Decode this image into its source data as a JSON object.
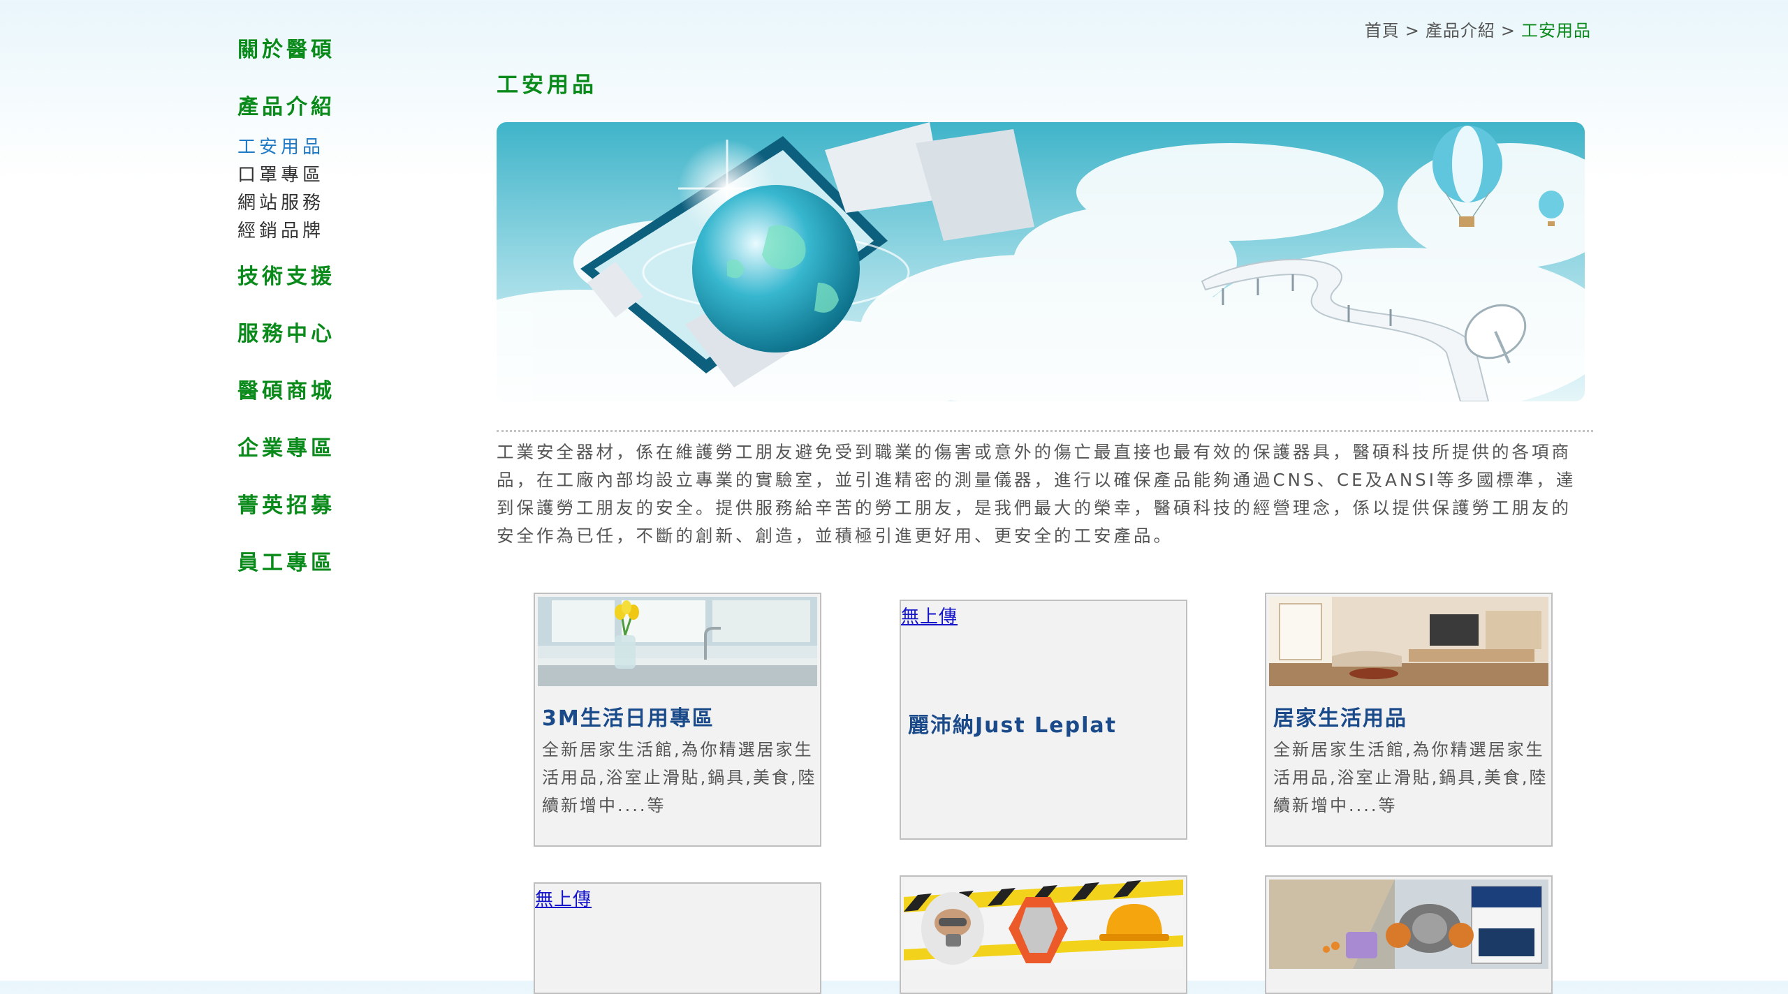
{
  "sidebar": {
    "items": [
      {
        "label": "關於醫碩"
      },
      {
        "label": "產品介紹",
        "children": [
          {
            "label": "工安用品",
            "active": true
          },
          {
            "label": "口罩專區"
          },
          {
            "label": "網站服務"
          },
          {
            "label": "經銷品牌"
          }
        ]
      },
      {
        "label": "技術支援"
      },
      {
        "label": "服務中心"
      },
      {
        "label": "醫碩商城"
      },
      {
        "label": "企業專區"
      },
      {
        "label": "菁英招募"
      },
      {
        "label": "員工專區"
      }
    ]
  },
  "breadcrumb": {
    "items": [
      "首頁",
      "產品介紹",
      "工安用品"
    ],
    "separator": ">"
  },
  "page_title": "工安用品",
  "intro_text": "工業安全器材，係在維護勞工朋友避免受到職業的傷害或意外的傷亡最直接也最有效的保護器具，醫碩科技所提供的各項商品，在工廠內部均設立專業的實驗室，並引進精密的測量儀器，進行以確保產品能夠通過CNS、CE及ANSI等多國標準，達到保護勞工朋友的安全。提供服務給辛苦的勞工朋友，是我們最大的榮幸，醫碩科技的經營理念，係以提供保護勞工朋友的安全作為已任，不斷的創新、創造，並積極引進更好用、更安全的工安產品。",
  "cards": [
    {
      "title": "3M生活日用專區",
      "desc": "全新居家生活館,為你精選居家生活用品,浴室止滑貼,鍋具,美食,陸續新增中....等",
      "image": "kitchen-window-photo"
    },
    {
      "title": "麗沛納Just Leplat",
      "no_image_text": "無上傳"
    },
    {
      "title": "居家生活用品",
      "desc": "全新居家生活館,為你精選居家生活用品,浴室止滑貼,鍋具,美食,陸續新增中....等",
      "image": "living-room-photo"
    },
    {
      "no_image_text": "無上傳"
    },
    {
      "image": "safety-gear-photo"
    },
    {
      "image": "respirator-photo"
    }
  ],
  "colors": {
    "nav_green": "#0a8a1a",
    "nav_active_blue": "#1f79c4",
    "card_title_blue": "#1a4a8a",
    "link_blue": "#1515cc"
  }
}
